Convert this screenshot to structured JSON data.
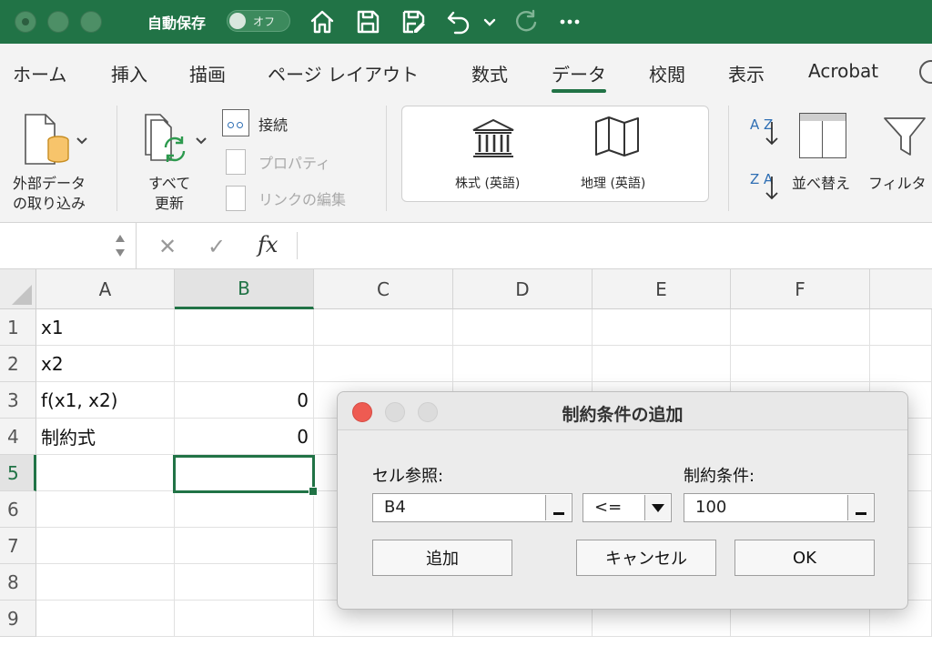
{
  "titlebar": {
    "autosave_label": "自動保存",
    "autosave_state": "オフ",
    "icons": [
      "home-icon",
      "save-icon",
      "save-edit-icon",
      "undo-icon",
      "chevron-down-icon",
      "redo-icon",
      "more-icon"
    ]
  },
  "tabs": [
    "ホーム",
    "挿入",
    "描画",
    "ページ レイアウト",
    "数式",
    "データ",
    "校閲",
    "表示",
    "Acrobat"
  ],
  "active_tab": "データ",
  "ribbon": {
    "get_data_line1": "外部データ",
    "get_data_line2": "の取り込み",
    "refresh_line1": "すべて",
    "refresh_line2": "更新",
    "connections": "接続",
    "properties": "プロパティ",
    "edit_links": "リンクの編集",
    "stocks": "株式 (英語)",
    "geography": "地理 (英語)",
    "sort_az": "A Z",
    "sort_za": "Z A",
    "sort": "並べ替え",
    "filter": "フィルタ"
  },
  "formula_bar": {
    "fx": "fx"
  },
  "grid": {
    "columns": [
      "A",
      "B",
      "C",
      "D",
      "E",
      "F"
    ],
    "rows": [
      "1",
      "2",
      "3",
      "4",
      "5",
      "6",
      "7",
      "8",
      "9"
    ],
    "cells": {
      "A1": "x1",
      "A2": "x2",
      "A3": "f(x1, x2)",
      "B3": "0",
      "A4": "制約式",
      "B4": "0"
    }
  },
  "dialog": {
    "title": "制約条件の追加",
    "cell_ref_label": "セル参照:",
    "cell_ref_value": "B4",
    "operator": "<=",
    "constraint_label": "制約条件:",
    "constraint_value": "100",
    "add_button": "追加",
    "cancel_button": "キャンセル",
    "ok_button": "OK"
  },
  "colors": {
    "accent": "#217346",
    "close": "#ee5b52"
  }
}
